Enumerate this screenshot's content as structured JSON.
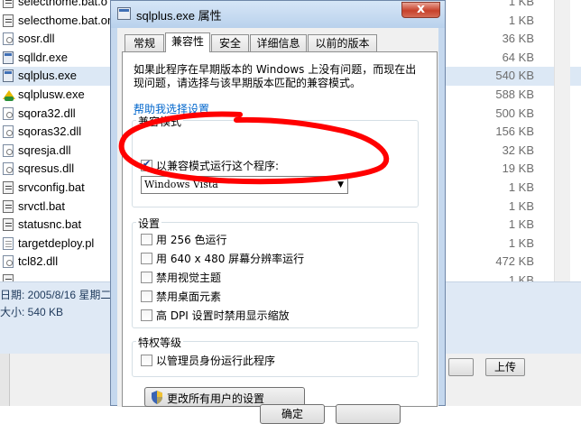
{
  "explorer": {
    "files": [
      {
        "name": "selecthome.bat.o",
        "size": "1 KB",
        "type": "bat"
      },
      {
        "name": "selecthome.bat.or",
        "size": "1 KB",
        "type": "bat"
      },
      {
        "name": "sosr.dll",
        "size": "36 KB",
        "type": "dll"
      },
      {
        "name": "sqlldr.exe",
        "size": "64 KB",
        "type": "exe"
      },
      {
        "name": "sqlplus.exe",
        "size": "540 KB",
        "type": "exe"
      },
      {
        "name": "sqlplusw.exe",
        "size": "588 KB",
        "type": "special"
      },
      {
        "name": "sqora32.dll",
        "size": "500 KB",
        "type": "dll"
      },
      {
        "name": "sqoras32.dll",
        "size": "156 KB",
        "type": "dll"
      },
      {
        "name": "sqresja.dll",
        "size": "32 KB",
        "type": "dll"
      },
      {
        "name": "sqresus.dll",
        "size": "19 KB",
        "type": "dll"
      },
      {
        "name": "srvconfig.bat",
        "size": "1 KB",
        "type": "bat"
      },
      {
        "name": "srvctl.bat",
        "size": "1 KB",
        "type": "bat"
      },
      {
        "name": "statusnc.bat",
        "size": "1 KB",
        "type": "bat"
      },
      {
        "name": "targetdeploy.pl",
        "size": "1 KB",
        "type": "pl"
      },
      {
        "name": "tcl82.dll",
        "size": "472 KB",
        "type": "dll"
      },
      {
        "name": "",
        "size": "1 KB",
        "type": "bat"
      }
    ],
    "selected_index": 4,
    "details": {
      "date_line": "日期: 2005/8/16 星期二",
      "size_line": "大小: 540 KB"
    },
    "upload_label": "上传"
  },
  "dialog": {
    "title": "sqlplus.exe 属性",
    "close_glyph": "x",
    "tabs": [
      {
        "label": "常规",
        "active": false
      },
      {
        "label": "兼容性",
        "active": true
      },
      {
        "label": "安全",
        "active": false
      },
      {
        "label": "详细信息",
        "active": false
      },
      {
        "label": "以前的版本",
        "active": false
      }
    ],
    "description": "如果此程序在早期版本的 Windows 上没有问题，而现在出现问题，请选择与该早期版本匹配的兼容模式。",
    "help_link": "帮助我选择设置",
    "compat_group": {
      "label": "兼容模式",
      "checkbox_label": "以兼容模式运行这个程序:",
      "checked": true,
      "selected_os": "Windows Vista"
    },
    "settings_group": {
      "label": "设置",
      "options": [
        {
          "label": "用 256 色运行",
          "checked": false
        },
        {
          "label": "用 640 x 480 屏幕分辨率运行",
          "checked": false
        },
        {
          "label": "禁用视觉主题",
          "checked": false
        },
        {
          "label": "禁用桌面元素",
          "checked": false
        },
        {
          "label": "高 DPI 设置时禁用显示缩放",
          "checked": false
        }
      ]
    },
    "privilege_group": {
      "label": "特权等级",
      "checkbox_label": "以管理员身份运行此程序",
      "checked": false
    },
    "all_users_button": "更改所有用户的设置",
    "ok_button": "确定"
  },
  "colors": {
    "annotation": "#ff0000",
    "link": "#0066cc",
    "selected_row": "#dce8f5"
  }
}
